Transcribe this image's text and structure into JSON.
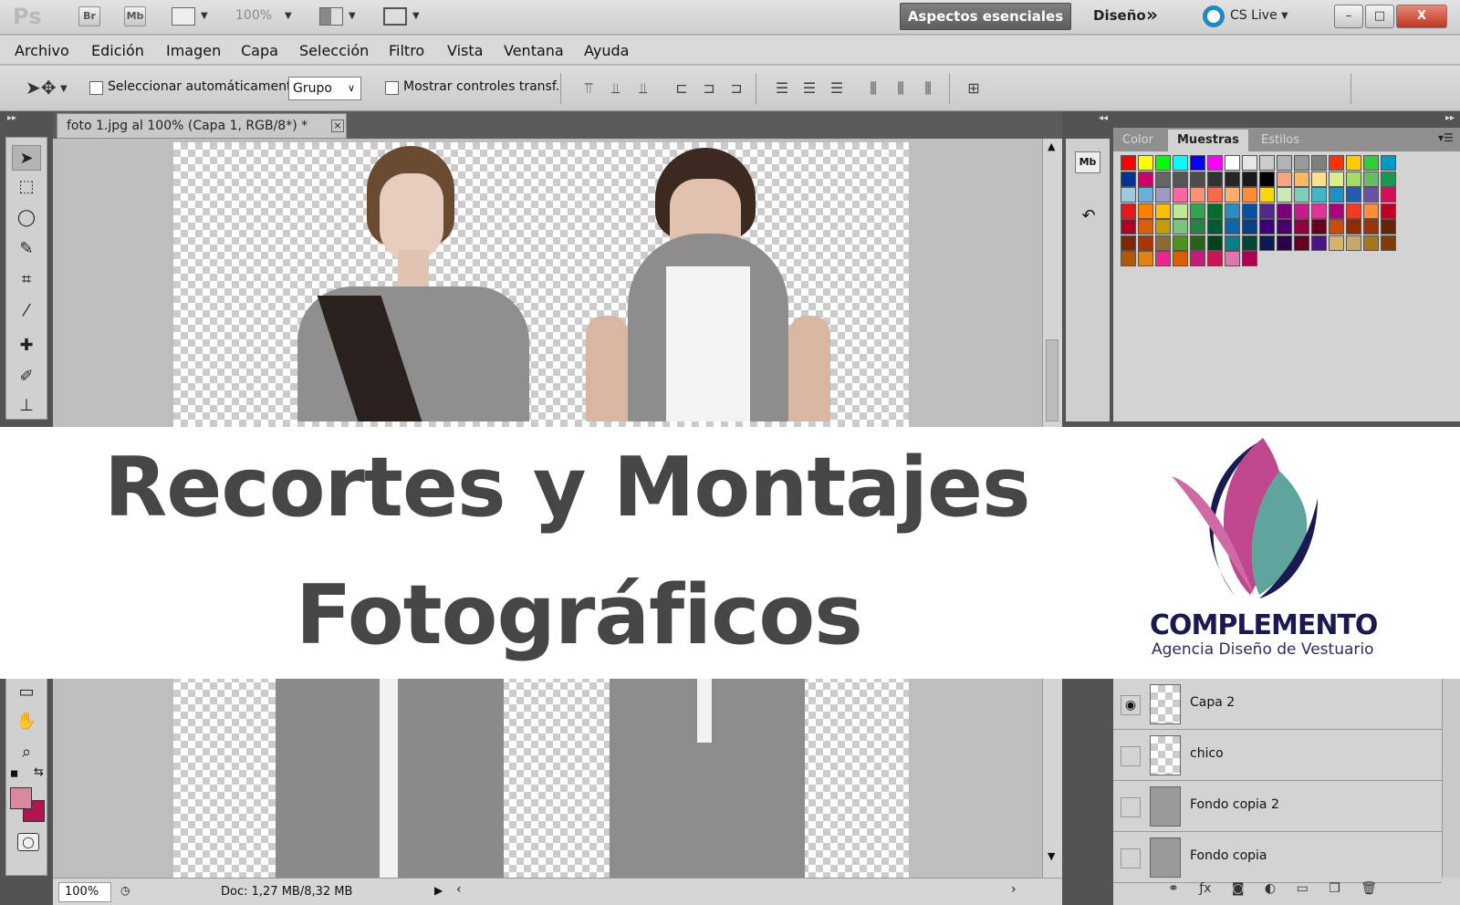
{
  "app": {
    "logo": "Ps",
    "bridge_label": "Br",
    "minibridge_label": "Mb",
    "zoom": "100%",
    "workspace_active": "Aspectos esenciales",
    "workspace_other": "Diseño",
    "overflow": "»",
    "cs_live": "CS Live",
    "win_min": "–",
    "win_max": "□",
    "win_close": "X"
  },
  "menu": [
    "Archivo",
    "Edición",
    "Imagen",
    "Capa",
    "Selección",
    "Filtro",
    "Vista",
    "Ventana",
    "Ayuda"
  ],
  "options": {
    "auto_select_label": "Seleccionar automáticamente:",
    "auto_select_value": "Grupo",
    "transform_label": "Mostrar controles transf."
  },
  "document": {
    "tab_title": "foto 1.jpg al 100% (Capa 1, RGB/8*) *",
    "tab_close": "×",
    "zoom": "100%",
    "doc_info": "Doc: 1,27 MB/8,32 MB"
  },
  "panel": {
    "tabs": [
      "Color",
      "Muestras",
      "Estilos"
    ],
    "active_tab": "Muestras",
    "mb_label": "Mb"
  },
  "layers": [
    {
      "name": "Capa 2",
      "visible": true
    },
    {
      "name": "chico",
      "visible": false
    },
    {
      "name": "Fondo copia 2",
      "visible": false
    },
    {
      "name": "Fondo copia",
      "visible": false
    }
  ],
  "banner": {
    "line1": "Recortes y Montajes",
    "line2": "Fotográficos",
    "brand": "COMPLEMENTO",
    "tagline": "Agencia Diseño de Vestuario"
  },
  "colors": {
    "foreground": "#d9889f",
    "background": "#b01551",
    "title_text": "#474546",
    "brand_navy": "#1a1a52",
    "logo_pink": "#c0468e",
    "logo_teal": "#5fa59b"
  },
  "swatches": [
    "#ff0000",
    "#ffff00",
    "#00ff00",
    "#00ffff",
    "#0000ff",
    "#ff00ff",
    "#ffffff",
    "#e6e6e6",
    "#cccccc",
    "#b3b3b3",
    "#999999",
    "#808080",
    "#ff3300",
    "#ffcc00",
    "#33cc33",
    "#0099cc",
    "#003399",
    "#cc0066",
    "#666666",
    "#555555",
    "#4d4d4d",
    "#333333",
    "#262626",
    "#1a1a1a",
    "#000000",
    "#f4a582",
    "#fdb863",
    "#fee08b",
    "#d9ef8b",
    "#a6d96a",
    "#66bd63",
    "#1a9850",
    "#9ecae1",
    "#6baed6",
    "#9e9ac8",
    "#f768a1",
    "#fc9272",
    "#fb6a4a",
    "#fdae6b",
    "#fd8d3c",
    "#ffd700",
    "#c7e9b4",
    "#7fcdbb",
    "#41b6c4",
    "#1d91c0",
    "#225ea8",
    "#6a51a3",
    "#ce1256",
    "#e31a1c",
    "#ff7f00",
    "#ffbf00",
    "#c2e699",
    "#31a354",
    "#006d2c",
    "#2b8cbe",
    "#08519c",
    "#54278f",
    "#7a0177",
    "#c51b8a",
    "#dd3497",
    "#ae017e",
    "#f03b20",
    "#fd8d3c",
    "#bd0026",
    "#b10026",
    "#d95f0e",
    "#c49c00",
    "#78c679",
    "#238443",
    "#005a32",
    "#0868ac",
    "#084081",
    "#3f007d",
    "#49006a",
    "#91003f",
    "#67001f",
    "#cc4c02",
    "#8c2d04",
    "#993404",
    "#662506",
    "#7f2704",
    "#a63603",
    "#8c6d31",
    "#4d9221",
    "#276419",
    "#00441b",
    "#02818a",
    "#014636",
    "#081d58",
    "#2d004b",
    "#67001f",
    "#4a1486",
    "#d8b365",
    "#c7a76c",
    "#a6761d",
    "#7f3b08",
    "#b35806",
    "#e08214",
    "#e7298a",
    "#d95f02",
    "#c51b7d",
    "#ce1256",
    "#de77ae",
    "#ad0052"
  ]
}
